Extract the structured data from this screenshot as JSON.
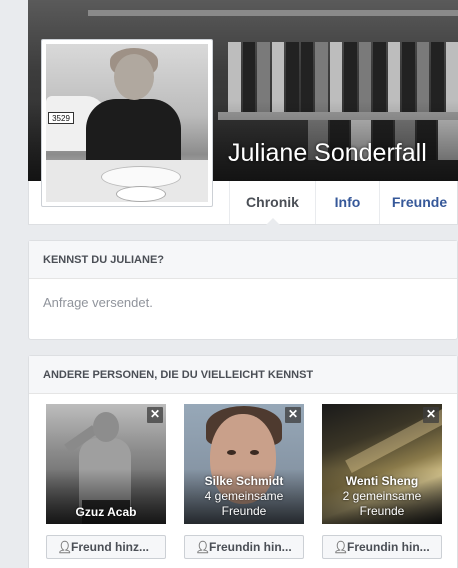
{
  "profile": {
    "name": "Juliane Sonderfall",
    "plate_text": "3529"
  },
  "tabs": [
    {
      "label": "Chronik",
      "active": true
    },
    {
      "label": "Info",
      "active": false
    },
    {
      "label": "Freunde",
      "active": false
    }
  ],
  "know_card": {
    "title": "KENNST DU JULIANE?",
    "status": "Anfrage versendet."
  },
  "pymk_card": {
    "title": "ANDERE PERSONEN, DIE DU VIELLEICHT KENNST",
    "people": [
      {
        "name": "Gzuz Acab",
        "mutual_line1": "",
        "mutual_line2": "",
        "button": "Freund hinz..."
      },
      {
        "name": "Silke Schmidt",
        "mutual_line1": "4 gemeinsame",
        "mutual_line2": "Freunde",
        "button": "Freundin hin..."
      },
      {
        "name": "Wenti Sheng",
        "mutual_line1": "2 gemeinsame",
        "mutual_line2": "Freunde",
        "button": "Freundin hin..."
      }
    ],
    "close_glyph": "✕",
    "add_icon": "add-friend-icon"
  },
  "colors": {
    "link": "#365899",
    "page_bg": "#e9ebee",
    "muted": "#90949c"
  }
}
